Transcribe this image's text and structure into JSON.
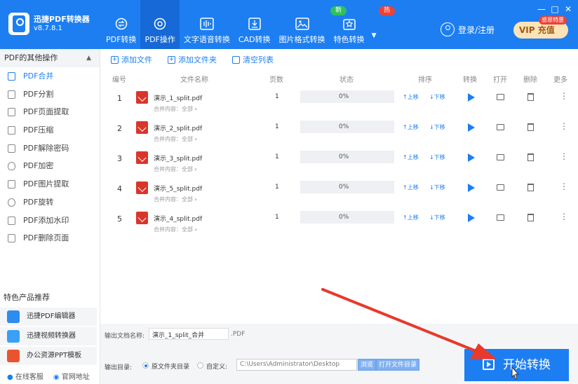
{
  "app": {
    "name": "迅捷PDF转换器",
    "version": "v8.7.8.1"
  },
  "nav": [
    {
      "label": "PDF转换",
      "icon": "convert-icon",
      "active": false
    },
    {
      "label": "PDF操作",
      "icon": "pdf-ops-icon",
      "active": true
    },
    {
      "label": "文字语音转换",
      "icon": "audio-icon",
      "active": false
    },
    {
      "label": "CAD转换",
      "icon": "cad-icon",
      "active": false
    },
    {
      "label": "图片格式转换",
      "icon": "image-icon",
      "active": false
    },
    {
      "label": "特色转换",
      "icon": "feature-icon",
      "active": false
    }
  ],
  "badges": {
    "new": "新",
    "hot": "热"
  },
  "header": {
    "login": "登录/注册",
    "vip": "VIP 充值",
    "vip_tag": "感恩特惠",
    "minimize": "—",
    "maximize": "□",
    "close": "✕"
  },
  "sidebar": {
    "title": "PDF的其他操作",
    "items": [
      {
        "label": "PDF合并",
        "active": true
      },
      {
        "label": "PDF分割"
      },
      {
        "label": "PDF页面提取"
      },
      {
        "label": "PDF压缩"
      },
      {
        "label": "PDF解除密码"
      },
      {
        "label": "PDF加密"
      },
      {
        "label": "PDF图片提取"
      },
      {
        "label": "PDF旋转"
      },
      {
        "label": "PDF添加水印"
      },
      {
        "label": "PDF删除页面"
      }
    ],
    "featured_title": "特色产品推荐",
    "featured": [
      {
        "label": "迅捷PDF编辑器",
        "color": "#2d8cf0"
      },
      {
        "label": "迅捷视频转换器",
        "color": "#3aa0f5"
      },
      {
        "label": "办公资源PPT模板",
        "color": "#e8542f"
      }
    ],
    "links": {
      "service": "在线客服",
      "website": "官网地址"
    }
  },
  "toolbar": {
    "add_file": "添加文件",
    "add_folder": "添加文件夹",
    "clear": "清空列表"
  },
  "table": {
    "headers": {
      "index": "编号",
      "name": "文件名称",
      "pages": "页数",
      "status": "状态",
      "sort": "排序",
      "convert": "转换",
      "open": "打开",
      "delete": "删除",
      "more": "更多"
    },
    "merge_label": "合并内容：",
    "merge_value": "全部",
    "up_label": "上移",
    "down_label": "下移",
    "rows": [
      {
        "index": "1",
        "name": "演示_1_split.pdf",
        "pages": "1",
        "progress": "0%"
      },
      {
        "index": "2",
        "name": "演示_2_split.pdf",
        "pages": "1",
        "progress": "0%"
      },
      {
        "index": "3",
        "name": "演示_3_split.pdf",
        "pages": "1",
        "progress": "0%"
      },
      {
        "index": "4",
        "name": "演示_5_split.pdf",
        "pages": "1",
        "progress": "0%"
      },
      {
        "index": "5",
        "name": "演示_4_split.pdf",
        "pages": "1",
        "progress": "0%"
      }
    ]
  },
  "output": {
    "name_label": "输出文档名称:",
    "name_value": "演示_1_split_合并",
    "ext": ".PDF",
    "dir_label": "输出目录:",
    "opt_original": "原文件夹目录",
    "opt_custom": "自定义:",
    "path": "C:\\Users\\Administrator\\Desktop",
    "browse": "浏览",
    "open_dir": "打开文件目录"
  },
  "start_button": "开始转换",
  "colors": {
    "primary": "#1d7ef2",
    "annotation_arrow": "#e8392b"
  }
}
